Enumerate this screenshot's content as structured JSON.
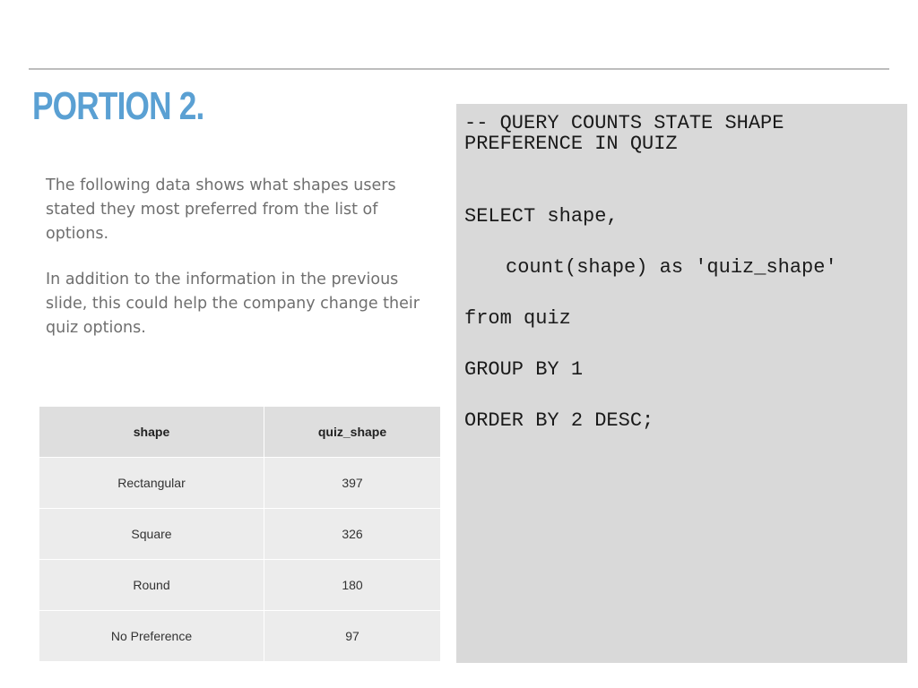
{
  "slide": {
    "title": "PORTION 2.",
    "paragraphs": [
      "The following data shows what shapes users stated they most preferred from the list of options.",
      "In addition to the information in the previous slide, this could help the company change their quiz options."
    ],
    "table": {
      "headers": [
        "shape",
        "quiz_shape"
      ],
      "rows": [
        [
          "Rectangular",
          "397"
        ],
        [
          "Square",
          "326"
        ],
        [
          "Round",
          "180"
        ],
        [
          "No Preference",
          "97"
        ]
      ]
    },
    "code": {
      "comment": "-- QUERY COUNTS STATE SHAPE\nPREFERENCE IN QUIZ",
      "select": "SELECT shape,",
      "count": "count(shape) as 'quiz_shape'",
      "from": "from quiz",
      "group_by": "GROUP BY 1",
      "order_by": "ORDER BY 2 DESC;"
    },
    "colors": {
      "title": "#5aa0d3",
      "body_text": "#6f6f6f",
      "code_panel": "#d9d9d9",
      "table_header": "#dedede",
      "table_cell": "#ececec"
    }
  }
}
